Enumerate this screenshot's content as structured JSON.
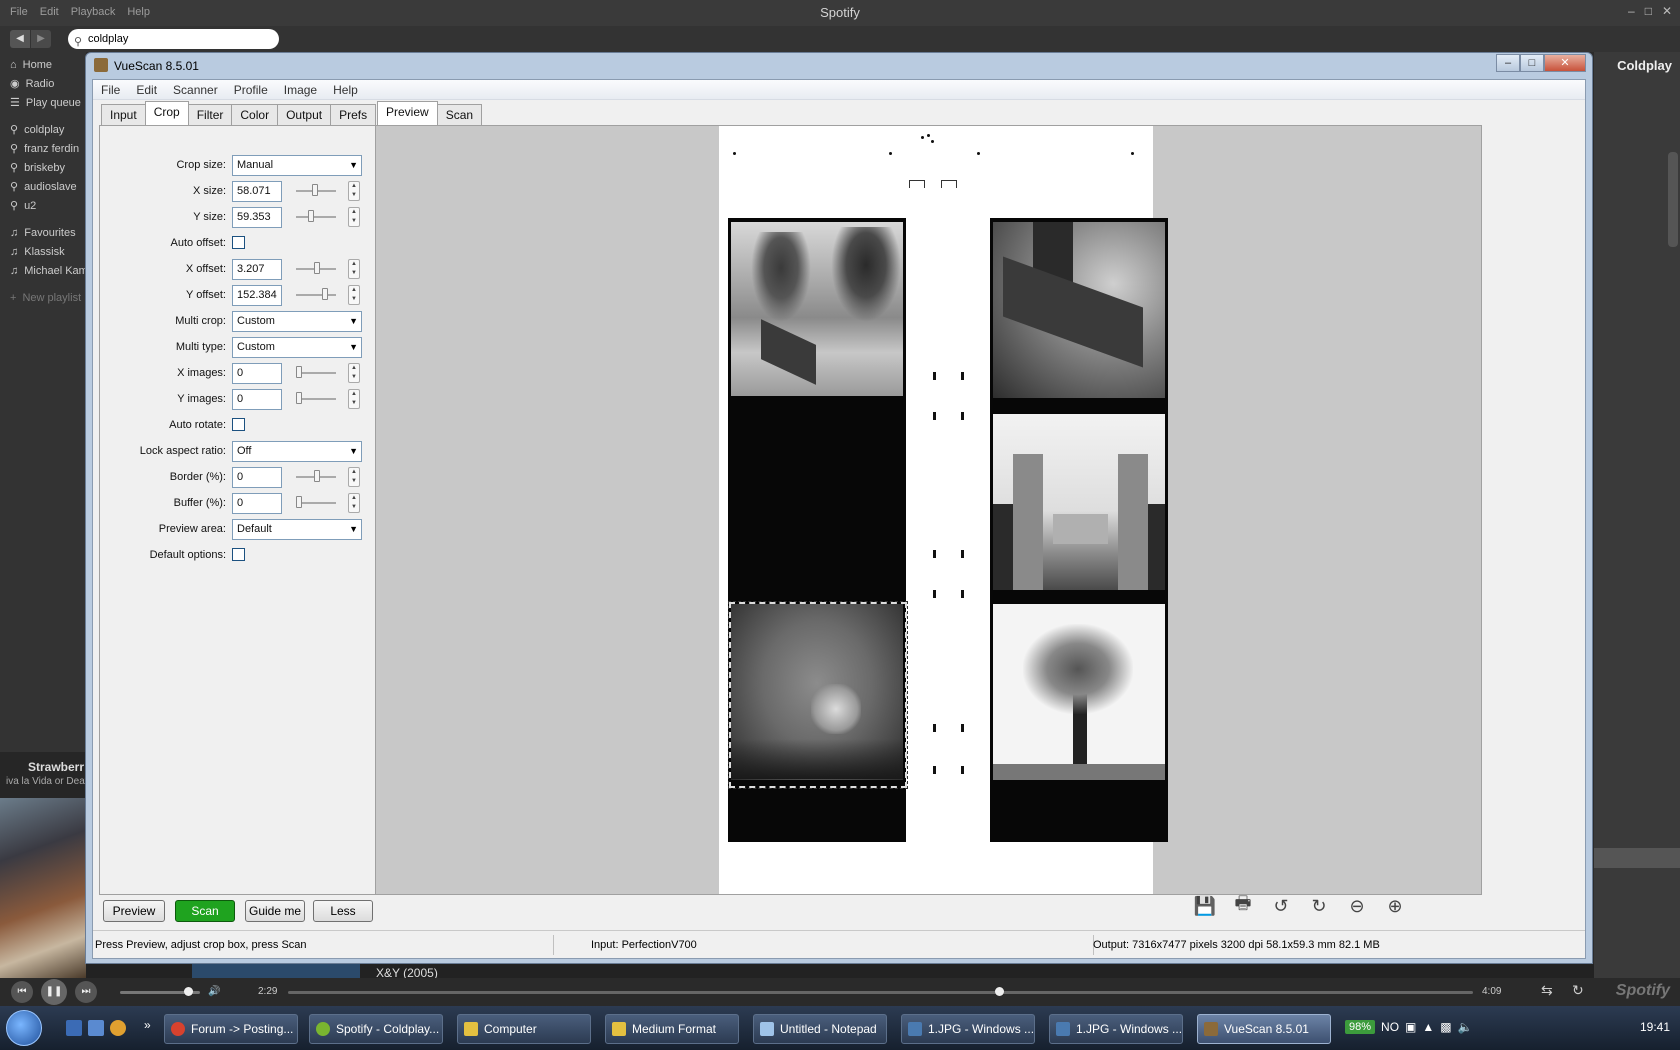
{
  "spotify": {
    "menu": [
      "File",
      "Edit",
      "Playback",
      "Help"
    ],
    "title": "Spotify",
    "search_value": "coldplay",
    "sidebar_main": [
      "Home",
      "Radio",
      "Play queue"
    ],
    "sidebar_searches": [
      "coldplay",
      "franz ferdin",
      "briskeby",
      "audioslave",
      "u2"
    ],
    "sidebar_playlists": [
      "Favourites",
      "Klassisk",
      "Michael Kam"
    ],
    "new_playlist": "New playlist",
    "now_playing": {
      "track": "Strawberr",
      "album": "iva la Vida or Deat"
    },
    "right_title": "Coldplay",
    "under_text": "X&Y    (2005)",
    "elapsed": "2:29",
    "duration": "4:09",
    "volume": 0.85,
    "progress": 0.6,
    "logo": "Spotify"
  },
  "vuescan": {
    "title": "VueScan 8.5.01",
    "menu": [
      "File",
      "Edit",
      "Scanner",
      "Profile",
      "Image",
      "Help"
    ],
    "left_tabs": [
      "Input",
      "Crop",
      "Filter",
      "Color",
      "Output",
      "Prefs"
    ],
    "active_left_tab": "Crop",
    "right_tabs": [
      "Preview",
      "Scan"
    ],
    "crop": {
      "crop_size": {
        "label": "Crop size:",
        "value": "Manual"
      },
      "x_size": {
        "label": "X size:",
        "value": "58.071"
      },
      "y_size": {
        "label": "Y size:",
        "value": "59.353"
      },
      "auto_offset": {
        "label": "Auto offset:"
      },
      "x_offset": {
        "label": "X offset:",
        "value": "3.207"
      },
      "y_offset": {
        "label": "Y offset:",
        "value": "152.384"
      },
      "multi_crop": {
        "label": "Multi crop:",
        "value": "Custom"
      },
      "multi_type": {
        "label": "Multi type:",
        "value": "Custom"
      },
      "x_images": {
        "label": "X images:",
        "value": "0"
      },
      "y_images": {
        "label": "Y images:",
        "value": "0"
      },
      "auto_rotate": {
        "label": "Auto rotate:"
      },
      "lock_aspect": {
        "label": "Lock aspect ratio:",
        "value": "Off"
      },
      "border": {
        "label": "Border (%):",
        "value": "0"
      },
      "buffer": {
        "label": "Buffer (%):",
        "value": "0"
      },
      "preview_area": {
        "label": "Preview area:",
        "value": "Default"
      },
      "default_options": {
        "label": "Default options:"
      }
    },
    "buttons": {
      "preview": "Preview",
      "scan": "Scan",
      "guide": "Guide me",
      "less": "Less"
    },
    "status": {
      "hint": "Press Preview, adjust crop box, press Scan",
      "input": "Input: PerfectionV700",
      "output": "Output: 7316x7477 pixels 3200 dpi 58.1x59.3 mm 82.1 MB"
    }
  },
  "taskbar": {
    "items": [
      "Forum -> Posting...",
      "Spotify - Coldplay...",
      "Computer",
      "Medium Format",
      "Untitled - Notepad",
      "1.JPG - Windows ...",
      "1.JPG - Windows ...",
      "VueScan 8.5.01"
    ],
    "battery": "98%",
    "lang": "NO",
    "clock": "19:41"
  }
}
